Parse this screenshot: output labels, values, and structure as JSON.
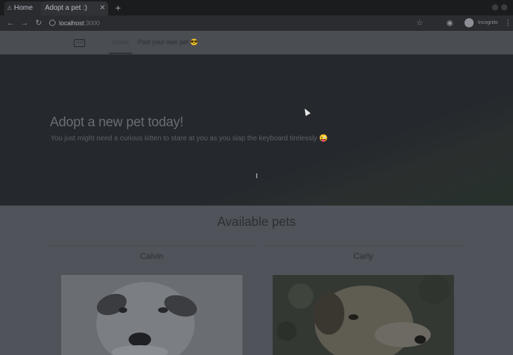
{
  "browser": {
    "tabs": [
      {
        "title": "Home",
        "active": false
      },
      {
        "title": "Adopt a pet :)",
        "active": true
      }
    ],
    "new_tab_symbol": "+",
    "address": {
      "host": "localhost",
      "port": ":3000"
    },
    "profile_label": "Incognito"
  },
  "nav": {
    "logo_icon": "dog-logo-icon",
    "links": [
      {
        "label": "Home",
        "active": true
      },
      {
        "label": "Post your own pet 😎",
        "active": false
      }
    ]
  },
  "hero": {
    "title": "Adopt a new pet today!",
    "subtitle": "You just might need a curious kitten to stare at you as you slap the keyboard tirelessly 😜",
    "cursor_text": "I"
  },
  "main": {
    "section_title": "Available pets",
    "pets": [
      {
        "name": "Calvin"
      },
      {
        "name": "Carly"
      }
    ]
  },
  "colors": {
    "hero_bg": "#25282d",
    "content_bg": "#505359",
    "nav_bg": "#4a4d52"
  }
}
